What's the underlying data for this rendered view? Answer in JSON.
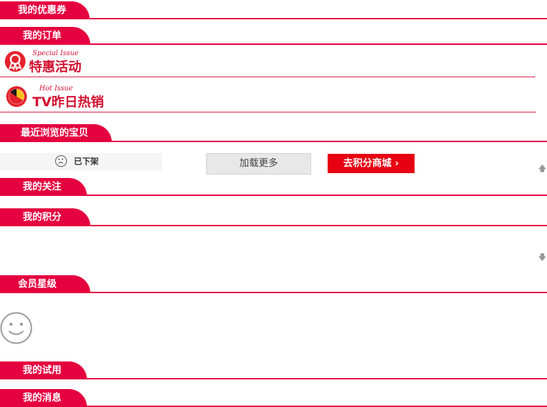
{
  "sections": {
    "coupons": "我的优惠券",
    "orders": "我的订单",
    "recent": "最近浏览的宝贝",
    "follow": "我的关注",
    "points": "我的积分",
    "member": "会员星级",
    "trial": "我的试用",
    "messages": "我的消息"
  },
  "promos": {
    "special": {
      "en": "Special Issue",
      "cn": "特惠活动"
    },
    "hot": {
      "en": "Hot Issue",
      "cn": "TV昨日热销"
    }
  },
  "recent": {
    "removed_label": "已下架",
    "load_more": "加载更多",
    "points_mall": "去积分商城 ›"
  },
  "icons": {
    "scroll_up": "arrow-up-icon",
    "scroll_down": "arrow-down-icon"
  },
  "colors": {
    "accent": "#e5003f",
    "button_red": "#e60012"
  }
}
